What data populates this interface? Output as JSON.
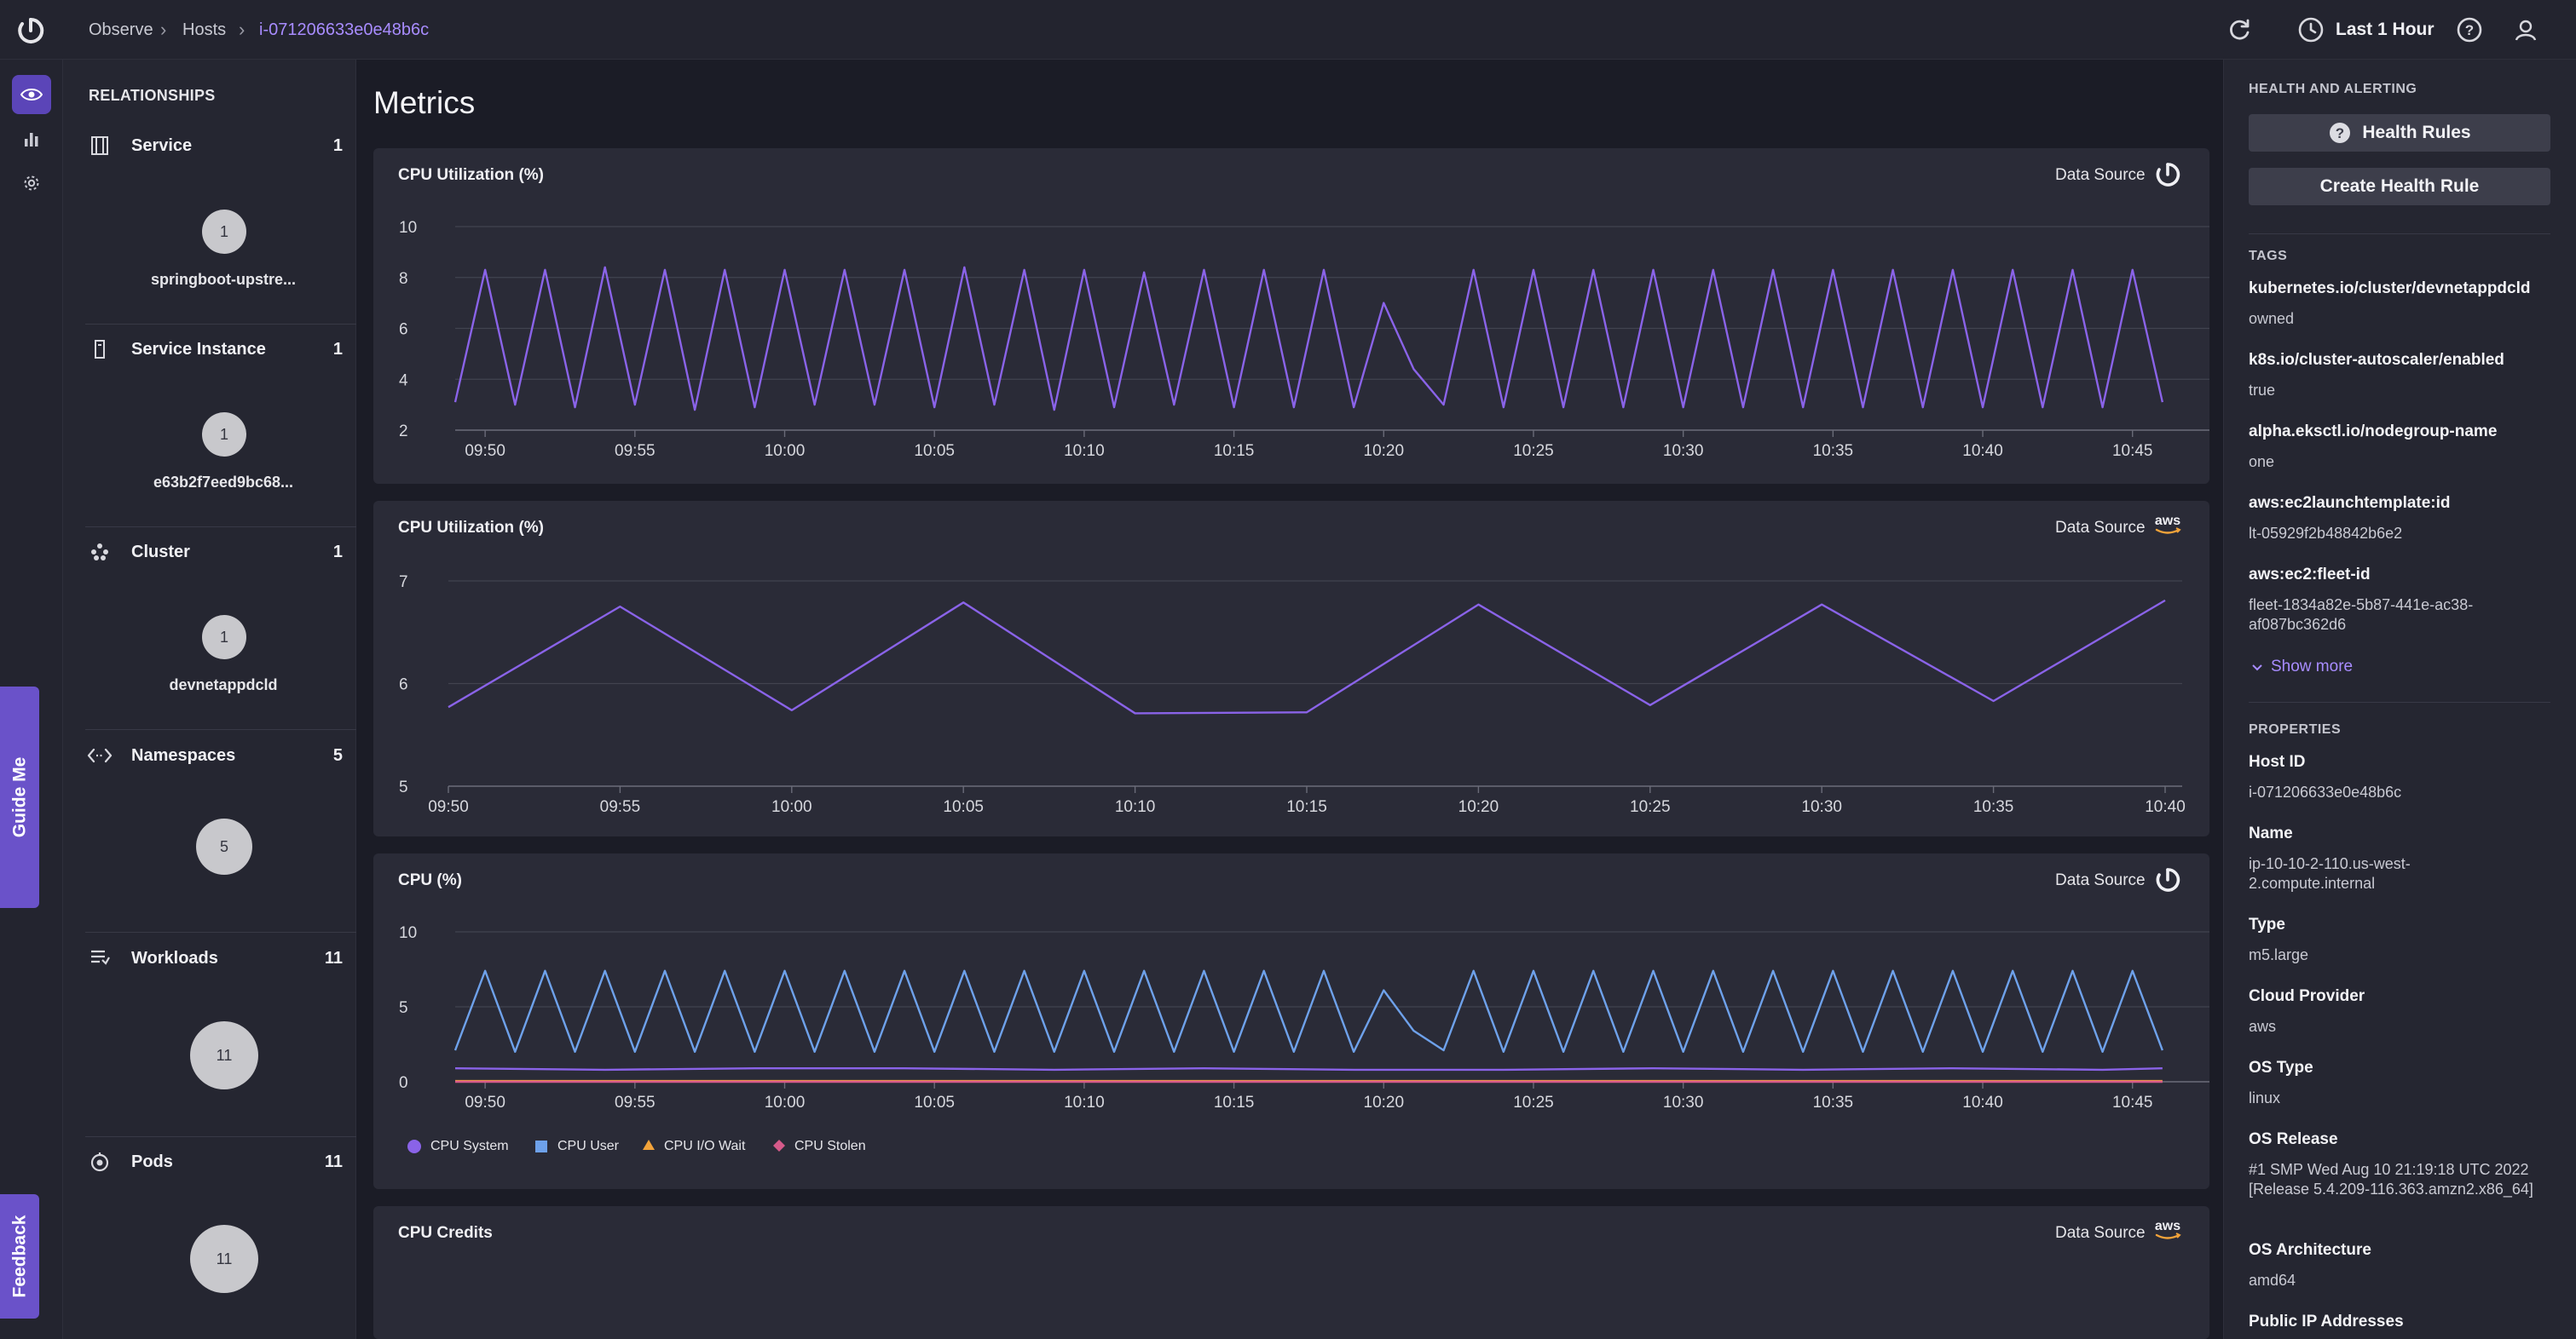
{
  "breadcrumb": {
    "items": [
      "Observe",
      "Hosts"
    ],
    "current": "i-071206633e0e48b6c"
  },
  "topbar": {
    "time_range": "Last 1 Hour"
  },
  "side_tabs": {
    "guide": "Guide Me",
    "feedback": "Feedback"
  },
  "relationships": {
    "title": "RELATIONSHIPS",
    "items": [
      {
        "label": "Service",
        "count": "1",
        "bubble": "1",
        "name": "springboot-upstre..."
      },
      {
        "label": "Service Instance",
        "count": "1",
        "bubble": "1",
        "name": "e63b2f7eed9bc68..."
      },
      {
        "label": "Cluster",
        "count": "1",
        "bubble": "1",
        "name": "devnetappdcld"
      },
      {
        "label": "Namespaces",
        "count": "5",
        "bubble": "5",
        "name": ""
      },
      {
        "label": "Workloads",
        "count": "11",
        "bubble": "11",
        "name": ""
      },
      {
        "label": "Pods",
        "count": "11",
        "bubble": "11",
        "name": ""
      }
    ]
  },
  "main": {
    "title": "Metrics",
    "data_source_label": "Data Source",
    "legend": [
      "CPU System",
      "CPU User",
      "CPU I/O Wait",
      "CPU Stolen"
    ]
  },
  "colors": {
    "accent": "#6a52c9",
    "purple_line": "#8a63e8",
    "blue_line": "#6ea1ea",
    "orange": "#f2a33a",
    "pink": "#d65a8a"
  },
  "chart_data": [
    {
      "type": "line",
      "title": "CPU Utilization (%)",
      "source": "appd-logo-icon",
      "ylim": [
        2,
        10
      ],
      "yticks": [
        2,
        4,
        6,
        8,
        10
      ],
      "xticks": [
        "09:50",
        "09:55",
        "10:00",
        "10:05",
        "10:10",
        "10:15",
        "10:20",
        "10:25",
        "10:30",
        "10:35",
        "10:40",
        "10:45"
      ],
      "xrange_min": [
        0,
        58
      ],
      "grid": true,
      "series": [
        {
          "values": [
            {
              "x": 0,
              "y": 3.1
            },
            {
              "x": 1,
              "y": 8.3
            },
            {
              "x": 2,
              "y": 3.0
            },
            {
              "x": 3,
              "y": 8.3
            },
            {
              "x": 4,
              "y": 2.9
            },
            {
              "x": 5,
              "y": 8.4
            },
            {
              "x": 6,
              "y": 3.0
            },
            {
              "x": 7,
              "y": 8.3
            },
            {
              "x": 8,
              "y": 2.8
            },
            {
              "x": 9,
              "y": 8.3
            },
            {
              "x": 10,
              "y": 2.9
            },
            {
              "x": 11,
              "y": 8.3
            },
            {
              "x": 12,
              "y": 3.0
            },
            {
              "x": 13,
              "y": 8.3
            },
            {
              "x": 14,
              "y": 3.0
            },
            {
              "x": 15,
              "y": 8.3
            },
            {
              "x": 16,
              "y": 2.9
            },
            {
              "x": 17,
              "y": 8.4
            },
            {
              "x": 18,
              "y": 3.0
            },
            {
              "x": 19,
              "y": 8.3
            },
            {
              "x": 20,
              "y": 2.8
            },
            {
              "x": 21,
              "y": 8.3
            },
            {
              "x": 22,
              "y": 2.9
            },
            {
              "x": 23,
              "y": 8.2
            },
            {
              "x": 24,
              "y": 3.0
            },
            {
              "x": 25,
              "y": 8.3
            },
            {
              "x": 26,
              "y": 2.9
            },
            {
              "x": 27,
              "y": 8.3
            },
            {
              "x": 28,
              "y": 2.9
            },
            {
              "x": 29,
              "y": 8.3
            },
            {
              "x": 30,
              "y": 2.9
            },
            {
              "x": 31,
              "y": 7.0
            },
            {
              "x": 32,
              "y": 4.4
            },
            {
              "x": 33,
              "y": 3.0
            },
            {
              "x": 34,
              "y": 8.3
            },
            {
              "x": 35,
              "y": 2.9
            },
            {
              "x": 36,
              "y": 8.3
            },
            {
              "x": 37,
              "y": 2.9
            },
            {
              "x": 38,
              "y": 8.3
            },
            {
              "x": 39,
              "y": 2.9
            },
            {
              "x": 40,
              "y": 8.3
            },
            {
              "x": 41,
              "y": 2.9
            },
            {
              "x": 42,
              "y": 8.3
            },
            {
              "x": 43,
              "y": 2.9
            },
            {
              "x": 44,
              "y": 8.3
            },
            {
              "x": 45,
              "y": 2.9
            },
            {
              "x": 46,
              "y": 8.3
            },
            {
              "x": 47,
              "y": 2.9
            },
            {
              "x": 48,
              "y": 8.3
            },
            {
              "x": 49,
              "y": 2.9
            },
            {
              "x": 50,
              "y": 8.3
            },
            {
              "x": 51,
              "y": 2.9
            },
            {
              "x": 52,
              "y": 8.3
            },
            {
              "x": 53,
              "y": 2.9
            },
            {
              "x": 54,
              "y": 8.3
            },
            {
              "x": 55,
              "y": 2.9
            },
            {
              "x": 56,
              "y": 8.3
            },
            {
              "x": 57,
              "y": 3.1
            }
          ]
        }
      ]
    },
    {
      "type": "line",
      "title": "CPU Utilization (%)",
      "source": "aws-logo-icon",
      "ylim": [
        5,
        7
      ],
      "yticks": [
        5,
        6,
        7
      ],
      "xticks": [
        "09:50",
        "09:55",
        "10:00",
        "10:05",
        "10:10",
        "10:15",
        "10:20",
        "10:25",
        "10:30",
        "10:35",
        "10:40"
      ],
      "xrange_min": [
        0,
        50
      ],
      "grid": true,
      "series": [
        {
          "values": [
            {
              "x": 0,
              "y": 5.77
            },
            {
              "x": 5,
              "y": 6.75
            },
            {
              "x": 10,
              "y": 5.74
            },
            {
              "x": 15,
              "y": 6.79
            },
            {
              "x": 20,
              "y": 5.71
            },
            {
              "x": 25,
              "y": 5.72
            },
            {
              "x": 30,
              "y": 6.77
            },
            {
              "x": 35,
              "y": 5.79
            },
            {
              "x": 40,
              "y": 6.77
            },
            {
              "x": 45,
              "y": 5.83
            },
            {
              "x": 50,
              "y": 6.81
            }
          ]
        }
      ]
    },
    {
      "type": "line",
      "title": "CPU (%)",
      "source": "appd-logo-icon",
      "ylim": [
        0,
        10
      ],
      "yticks": [
        0,
        5,
        10
      ],
      "xticks": [
        "09:50",
        "09:55",
        "10:00",
        "10:05",
        "10:10",
        "10:15",
        "10:20",
        "10:25",
        "10:30",
        "10:35",
        "10:40",
        "10:45"
      ],
      "xrange_min": [
        0,
        58
      ],
      "grid": true,
      "legend": "bottom-left",
      "series": [
        {
          "name": "CPU System",
          "values": [
            {
              "x": 0,
              "y": 0.9
            },
            {
              "x": 5,
              "y": 0.8
            },
            {
              "x": 10,
              "y": 0.9
            },
            {
              "x": 15,
              "y": 0.9
            },
            {
              "x": 20,
              "y": 0.8
            },
            {
              "x": 25,
              "y": 0.9
            },
            {
              "x": 30,
              "y": 0.8
            },
            {
              "x": 35,
              "y": 0.8
            },
            {
              "x": 40,
              "y": 0.9
            },
            {
              "x": 45,
              "y": 0.8
            },
            {
              "x": 50,
              "y": 0.9
            },
            {
              "x": 55,
              "y": 0.8
            },
            {
              "x": 57,
              "y": 0.9
            }
          ]
        },
        {
          "name": "CPU User",
          "values": [
            {
              "x": 0,
              "y": 2.1
            },
            {
              "x": 1,
              "y": 7.4
            },
            {
              "x": 2,
              "y": 2.0
            },
            {
              "x": 3,
              "y": 7.4
            },
            {
              "x": 4,
              "y": 2.0
            },
            {
              "x": 5,
              "y": 7.4
            },
            {
              "x": 6,
              "y": 2.0
            },
            {
              "x": 7,
              "y": 7.4
            },
            {
              "x": 8,
              "y": 2.0
            },
            {
              "x": 9,
              "y": 7.4
            },
            {
              "x": 10,
              "y": 2.0
            },
            {
              "x": 11,
              "y": 7.4
            },
            {
              "x": 12,
              "y": 2.0
            },
            {
              "x": 13,
              "y": 7.4
            },
            {
              "x": 14,
              "y": 2.0
            },
            {
              "x": 15,
              "y": 7.4
            },
            {
              "x": 16,
              "y": 2.0
            },
            {
              "x": 17,
              "y": 7.4
            },
            {
              "x": 18,
              "y": 2.0
            },
            {
              "x": 19,
              "y": 7.4
            },
            {
              "x": 20,
              "y": 2.0
            },
            {
              "x": 21,
              "y": 7.4
            },
            {
              "x": 22,
              "y": 2.0
            },
            {
              "x": 23,
              "y": 7.4
            },
            {
              "x": 24,
              "y": 2.0
            },
            {
              "x": 25,
              "y": 7.4
            },
            {
              "x": 26,
              "y": 2.0
            },
            {
              "x": 27,
              "y": 7.4
            },
            {
              "x": 28,
              "y": 2.0
            },
            {
              "x": 29,
              "y": 7.4
            },
            {
              "x": 30,
              "y": 2.0
            },
            {
              "x": 31,
              "y": 6.1
            },
            {
              "x": 32,
              "y": 3.4
            },
            {
              "x": 33,
              "y": 2.1
            },
            {
              "x": 34,
              "y": 7.4
            },
            {
              "x": 35,
              "y": 2.0
            },
            {
              "x": 36,
              "y": 7.4
            },
            {
              "x": 37,
              "y": 2.0
            },
            {
              "x": 38,
              "y": 7.4
            },
            {
              "x": 39,
              "y": 2.0
            },
            {
              "x": 40,
              "y": 7.4
            },
            {
              "x": 41,
              "y": 2.0
            },
            {
              "x": 42,
              "y": 7.4
            },
            {
              "x": 43,
              "y": 2.0
            },
            {
              "x": 44,
              "y": 7.4
            },
            {
              "x": 45,
              "y": 2.0
            },
            {
              "x": 46,
              "y": 7.4
            },
            {
              "x": 47,
              "y": 2.0
            },
            {
              "x": 48,
              "y": 7.4
            },
            {
              "x": 49,
              "y": 2.0
            },
            {
              "x": 50,
              "y": 7.4
            },
            {
              "x": 51,
              "y": 2.0
            },
            {
              "x": 52,
              "y": 7.4
            },
            {
              "x": 53,
              "y": 2.0
            },
            {
              "x": 54,
              "y": 7.4
            },
            {
              "x": 55,
              "y": 2.0
            },
            {
              "x": 56,
              "y": 7.4
            },
            {
              "x": 57,
              "y": 2.1
            }
          ]
        },
        {
          "name": "CPU I/O Wait",
          "values": [
            {
              "x": 0,
              "y": 0.05
            },
            {
              "x": 57,
              "y": 0.05
            }
          ]
        },
        {
          "name": "CPU Stolen",
          "values": [
            {
              "x": 0,
              "y": 0.0
            },
            {
              "x": 57,
              "y": 0.0
            }
          ]
        }
      ]
    },
    {
      "type": "line",
      "title": "CPU Credits",
      "source": "aws-logo-icon",
      "series": []
    }
  ],
  "right_panel": {
    "health_heading": "HEALTH AND ALERTING",
    "health_rules_btn": "Health Rules",
    "create_rule_btn": "Create Health Rule",
    "tags_heading": "TAGS",
    "tags": [
      {
        "key": "kubernetes.io/cluster/devnetappdcld",
        "value": "owned"
      },
      {
        "key": "k8s.io/cluster-autoscaler/enabled",
        "value": "true"
      },
      {
        "key": "alpha.eksctl.io/nodegroup-name",
        "value": "one"
      },
      {
        "key": "aws:ec2launchtemplate:id",
        "value": "lt-05929f2b48842b6e2"
      },
      {
        "key": "aws:ec2:fleet-id",
        "value": "fleet-1834a82e-5b87-441e-ac38-af087bc362d6"
      }
    ],
    "show_more": "Show more",
    "props_heading": "PROPERTIES",
    "props": [
      {
        "key": "Host ID",
        "value": "i-071206633e0e48b6c"
      },
      {
        "key": "Name",
        "value": "ip-10-10-2-110.us-west-2.compute.internal"
      },
      {
        "key": "Type",
        "value": "m5.large"
      },
      {
        "key": "Cloud Provider",
        "value": "aws"
      },
      {
        "key": "OS Type",
        "value": "linux"
      },
      {
        "key": "OS Release",
        "value": "#1 SMP Wed Aug 10 21:19:18 UTC 2022 [Release 5.4.209-116.363.amzn2.x86_64]"
      },
      {
        "key": "OS Architecture",
        "value": "amd64"
      },
      {
        "key": "Public IP Addresses",
        "value": ""
      }
    ]
  }
}
